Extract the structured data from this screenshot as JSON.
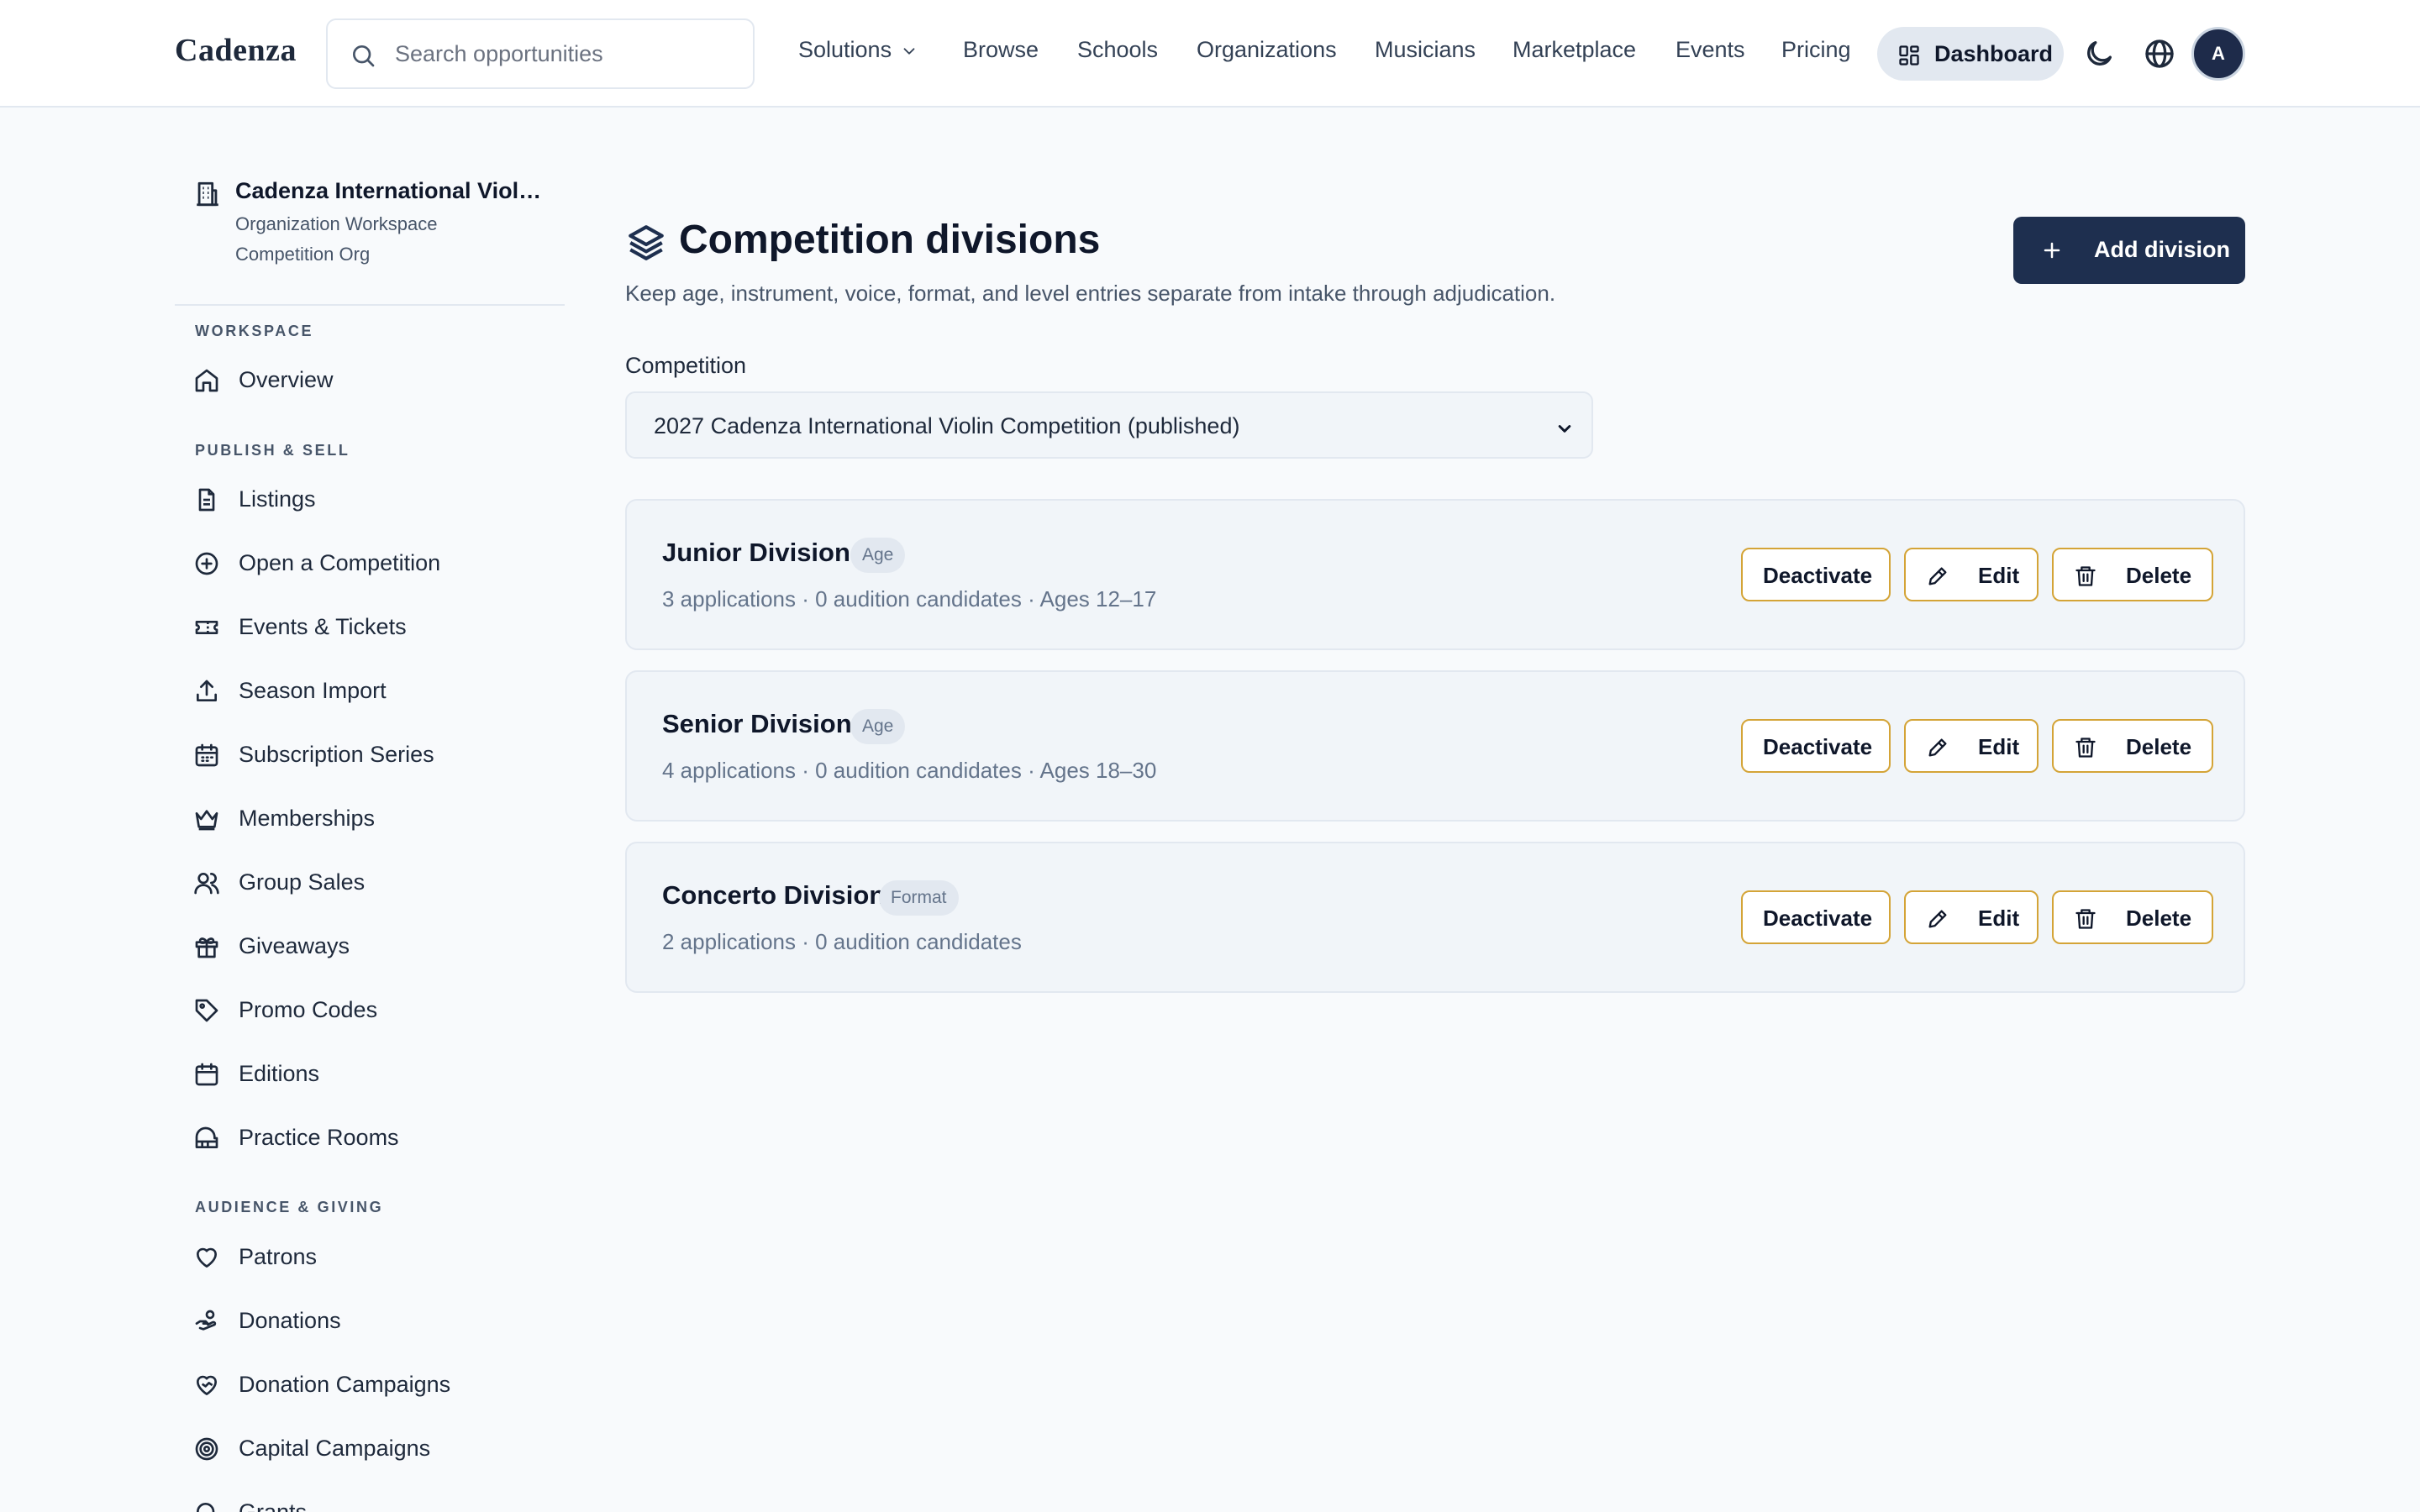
{
  "header": {
    "brand": "Cadenza",
    "search_placeholder": "Search opportunities",
    "nav": [
      "Solutions",
      "Browse",
      "Schools",
      "Organizations",
      "Musicians",
      "Marketplace",
      "Events",
      "Pricing"
    ],
    "dashboard_label": "Dashboard",
    "avatar_initial": "A",
    "icons": {
      "search": "search-icon",
      "solutions_caret": "chevron-down-icon",
      "dashboard": "layout-grid-icon",
      "theme": "moon-icon",
      "language": "globe-icon"
    }
  },
  "sidebar": {
    "org": {
      "name": "Cadenza International Violin Competition",
      "workspace": "Organization Workspace",
      "type": "Competition Org",
      "icon": "building-icon"
    },
    "sections": [
      {
        "title": "WORKSPACE",
        "items": [
          {
            "label": "Overview",
            "icon": "home-icon"
          }
        ]
      },
      {
        "title": "PUBLISH & SELL",
        "items": [
          {
            "label": "Listings",
            "icon": "file-text-icon"
          },
          {
            "label": "Open a Competition",
            "icon": "plus-circle-icon"
          },
          {
            "label": "Events & Tickets",
            "icon": "ticket-icon"
          },
          {
            "label": "Season Import",
            "icon": "upload-icon"
          },
          {
            "label": "Subscription Series",
            "icon": "calendar-days-icon"
          },
          {
            "label": "Memberships",
            "icon": "crown-icon"
          },
          {
            "label": "Group Sales",
            "icon": "users-icon"
          },
          {
            "label": "Giveaways",
            "icon": "gift-icon"
          },
          {
            "label": "Promo Codes",
            "icon": "tag-icon"
          },
          {
            "label": "Editions",
            "icon": "calendar-icon"
          },
          {
            "label": "Practice Rooms",
            "icon": "piano-icon"
          }
        ]
      },
      {
        "title": "AUDIENCE & GIVING",
        "items": [
          {
            "label": "Patrons",
            "icon": "heart-icon"
          },
          {
            "label": "Donations",
            "icon": "hand-coins-icon"
          },
          {
            "label": "Donation Campaigns",
            "icon": "heart-handshake-icon"
          },
          {
            "label": "Capital Campaigns",
            "icon": "target-icon"
          },
          {
            "label": "Grants",
            "icon": "search-icon"
          }
        ]
      }
    ]
  },
  "main": {
    "title": "Competition divisions",
    "title_icon": "layers-icon",
    "subtitle": "Keep age, instrument, voice, format, and level entries separate from intake through adjudication.",
    "add_button": "Add division",
    "competition_label": "Competition",
    "competition_selected": "2027 Cadenza International Violin Competition (published)",
    "action_labels": {
      "deactivate": "Deactivate",
      "edit": "Edit",
      "delete": "Delete"
    },
    "divisions": [
      {
        "name": "Junior Division",
        "badge": "Age",
        "meta": "3 applications · 0 audition candidates · Ages 12–17"
      },
      {
        "name": "Senior Division",
        "badge": "Age",
        "meta": "4 applications · 0 audition candidates · Ages 18–30"
      },
      {
        "name": "Concerto Division",
        "badge": "Format",
        "meta": "2 applications · 0 audition candidates"
      }
    ]
  },
  "colors": {
    "primary": "#1e2f4f",
    "accent_border": "#d4a437",
    "page_bg": "#f8fafc",
    "card_bg": "#f1f5f9"
  }
}
